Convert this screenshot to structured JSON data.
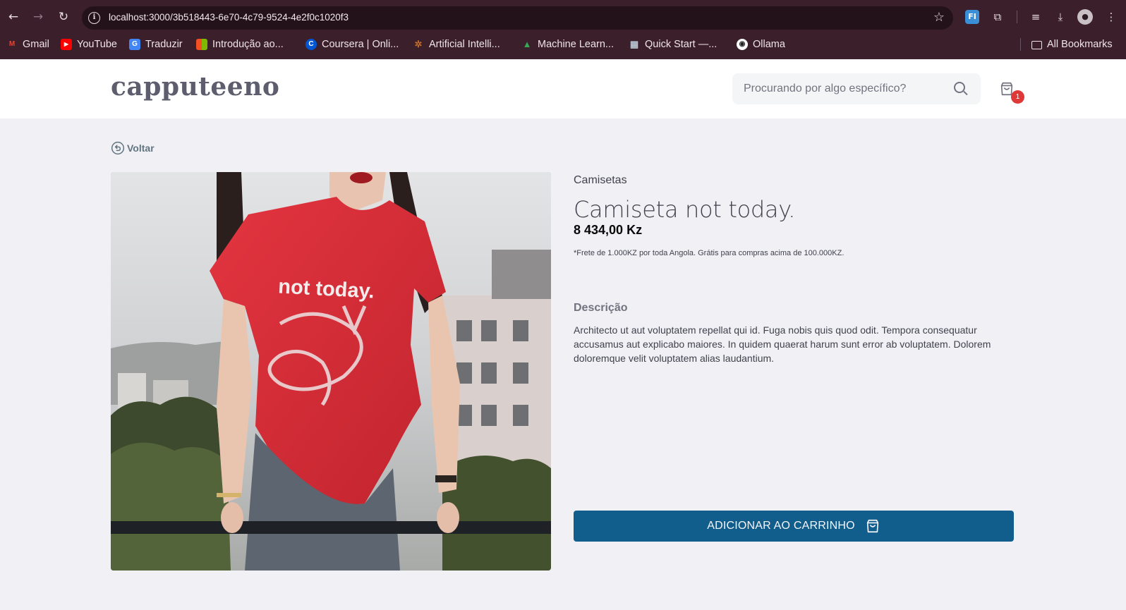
{
  "browser": {
    "url": "localhost:3000/3b518443-6e70-4c79-9524-4e2f0c1020f3",
    "bookmarks": [
      {
        "label": "Gmail",
        "icon": "gmail-icon",
        "color": "#ea4335",
        "glyph": "M"
      },
      {
        "label": "YouTube",
        "icon": "youtube-icon",
        "color": "#ff0000",
        "glyph": "▶"
      },
      {
        "label": "Traduzir",
        "icon": "translate-icon",
        "color": "#4285f4",
        "glyph": "G"
      },
      {
        "label": "Introdução ao...",
        "icon": "microsoft-icon",
        "color": "#f25022",
        "glyph": "■"
      },
      {
        "label": "Coursera | Onli...",
        "icon": "coursera-icon",
        "color": "#0056d2",
        "glyph": "C"
      },
      {
        "label": "Artificial Intelli...",
        "icon": "ai-icon",
        "color": "#c06a2b",
        "glyph": "✲"
      },
      {
        "label": "Machine Learn...",
        "icon": "drive-icon",
        "color": "#34a853",
        "glyph": "▲"
      },
      {
        "label": "Quick Start —...",
        "icon": "docs-icon",
        "color": "#6b7c8f",
        "glyph": "▦"
      },
      {
        "label": "Ollama",
        "icon": "ollama-icon",
        "color": "#ffffff",
        "glyph": "◉"
      }
    ],
    "all_bookmarks": "All Bookmarks"
  },
  "header": {
    "logo": "capputeeno",
    "search_placeholder": "Procurando por algo específico?",
    "cart_count": "1"
  },
  "page": {
    "back_label": "Voltar"
  },
  "product": {
    "category": "Camisetas",
    "name": "Camiseta not today.",
    "price": "8 434,00 Kz",
    "shipping_note": "*Frete de 1.000KZ por toda Angola. Grátis para compras acima de 100.000KZ.",
    "description_title": "Descrição",
    "description": "Architecto ut aut voluptatem repellat qui id. Fuga nobis quis quod odit. Tempora consequatur accusamus aut explicabo maiores. In quidem quaerat harum sunt error ab voluptatem. Dolorem doloremque velit voluptatem alias laudantium.",
    "shirt_print": "not today.",
    "add_to_cart_label": "ADICIONAR AO CARRINHO"
  },
  "colors": {
    "button": "#115d8c",
    "badge": "#de3838",
    "shirt": "#d9303a"
  }
}
